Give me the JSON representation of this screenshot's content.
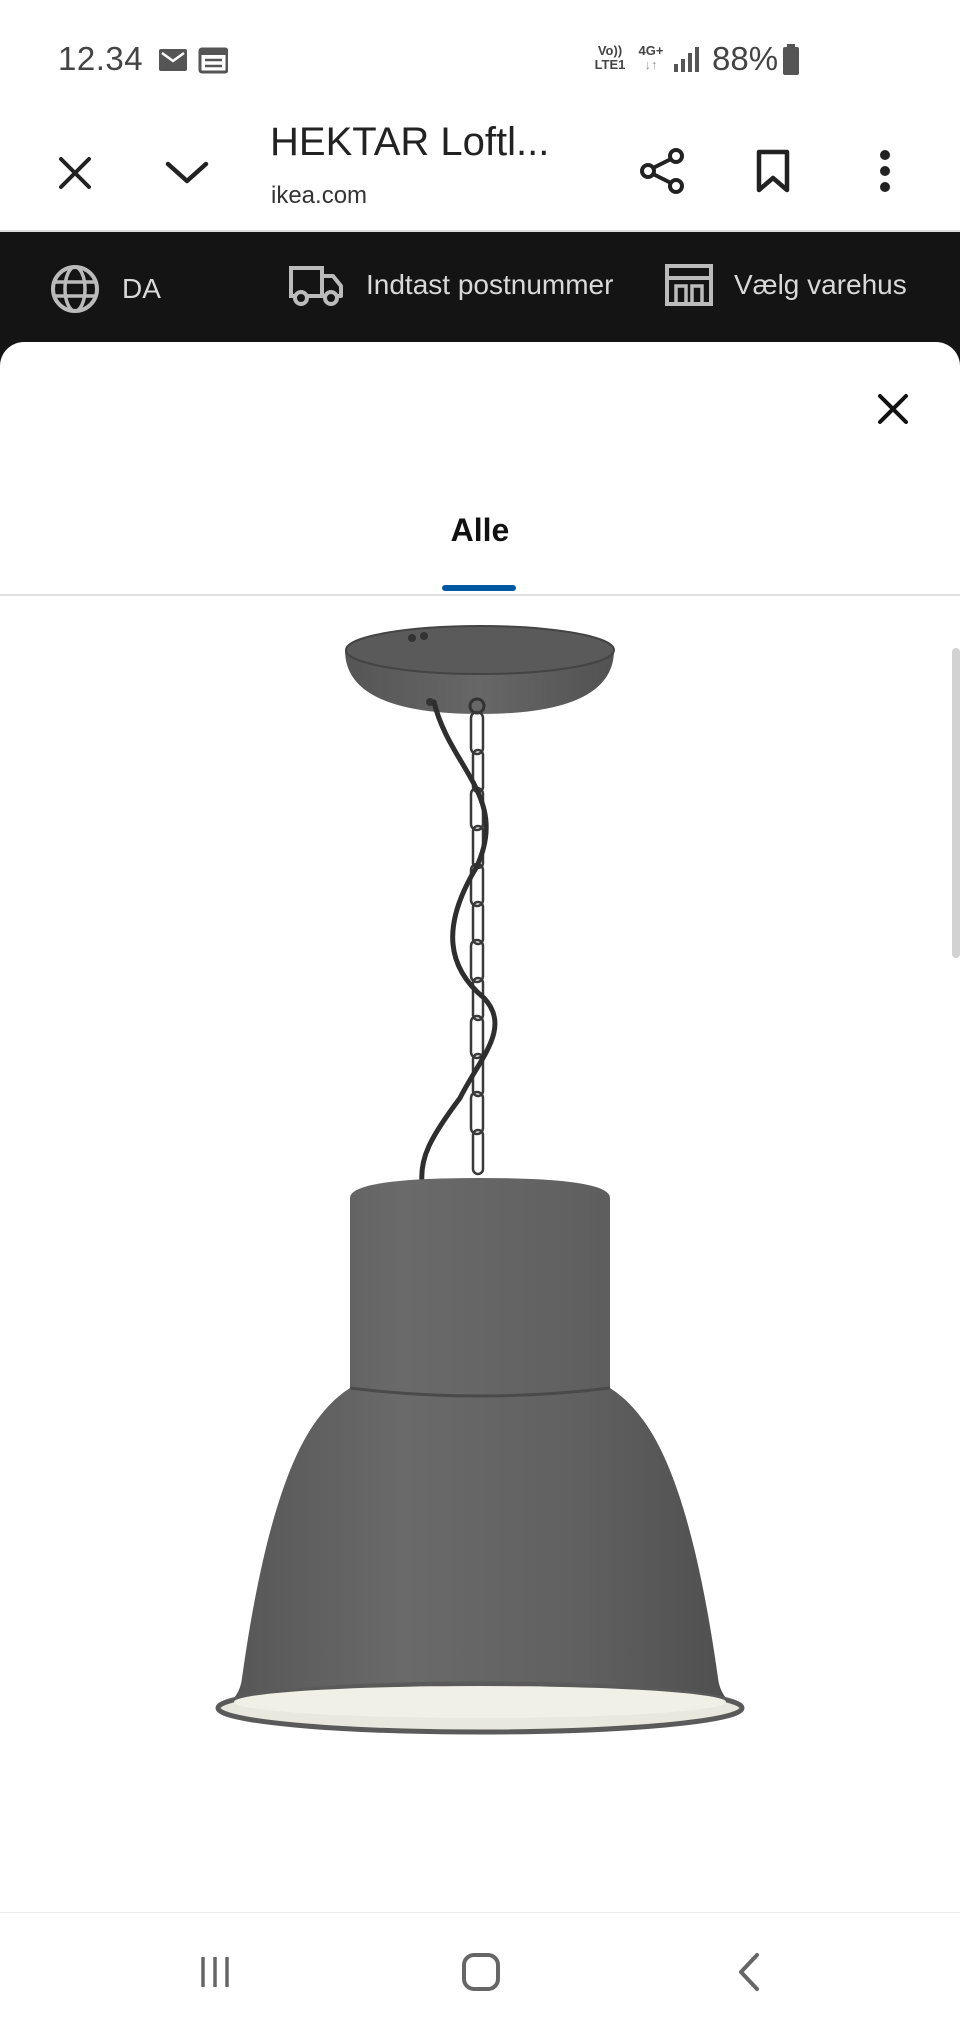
{
  "status_bar": {
    "time": "12.34",
    "network_top": "Vo))",
    "network_bottom": "LTE1",
    "network_gen": "4G+",
    "battery": "88%"
  },
  "browser": {
    "title": "HEKTAR Loftl...",
    "url": "ikea.com"
  },
  "ikea_bar": {
    "language": "DA",
    "postcode": "Indtast postnummer",
    "store": "Vælg varehus"
  },
  "gallery": {
    "tab_label": "Alle",
    "product_image_alt": "HEKTAR pendant lamp, dark grey"
  },
  "colors": {
    "ikea_bar_bg": "#141414",
    "tab_accent": "#0058a3",
    "lamp_color": "#5e5e5e"
  }
}
